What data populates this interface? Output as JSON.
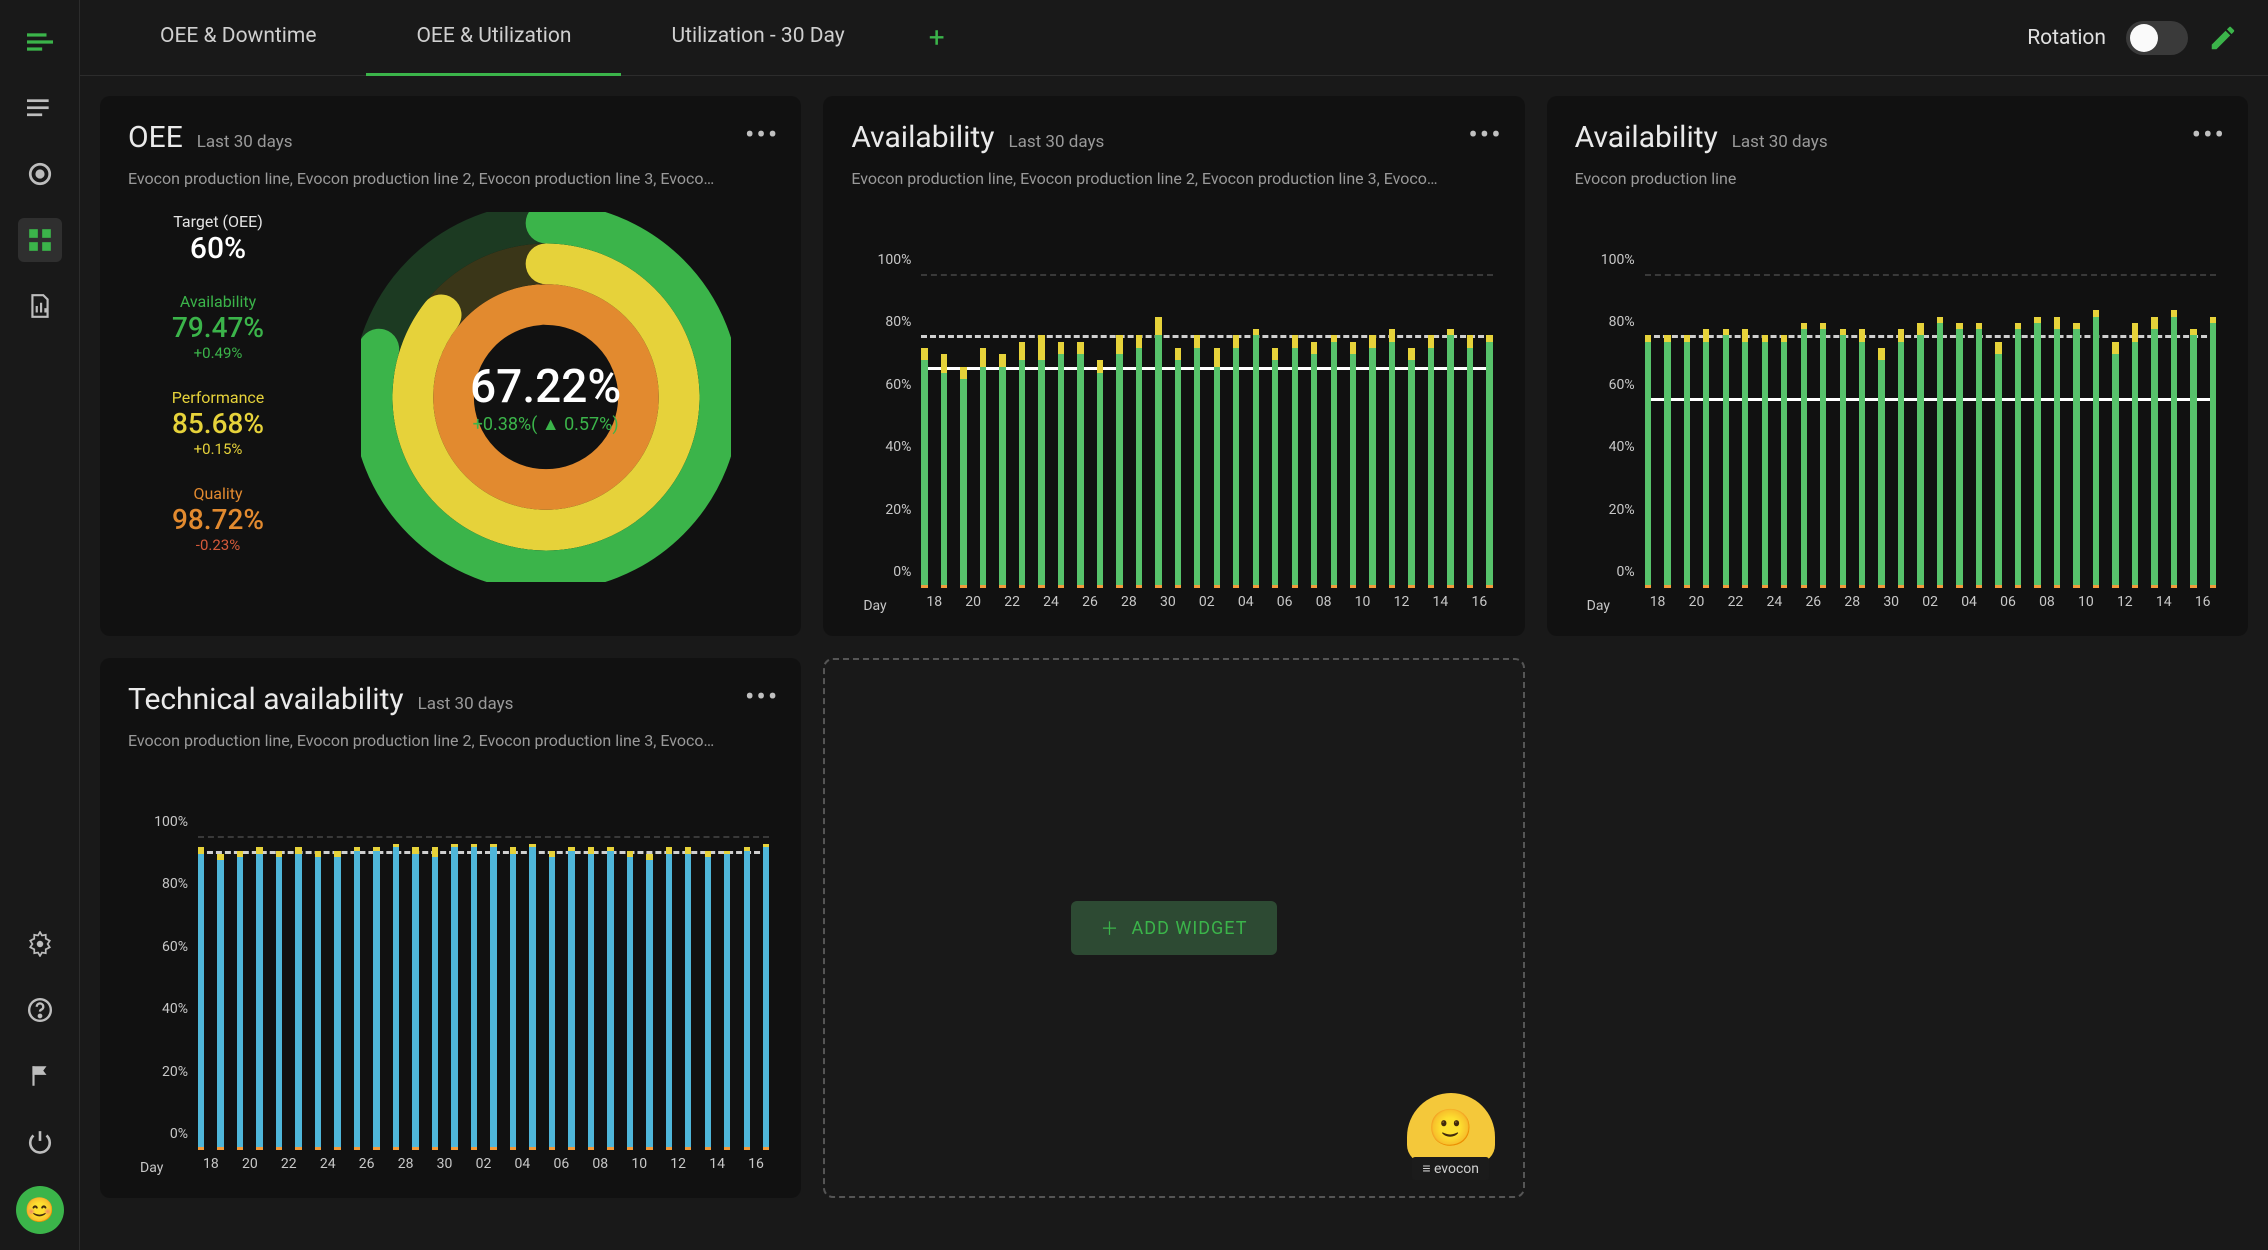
{
  "sidebar": {
    "icons": [
      "menu",
      "list",
      "target",
      "dashboard",
      "report"
    ],
    "bottom_icons": [
      "gear",
      "help",
      "flag",
      "power"
    ]
  },
  "tabs": [
    {
      "label": "OEE & Downtime",
      "active": false
    },
    {
      "label": "OEE & Utilization",
      "active": true
    },
    {
      "label": "Utilization - 30 Day",
      "active": false
    }
  ],
  "rotation": {
    "label": "Rotation",
    "on": false
  },
  "cards": {
    "oee": {
      "title": "OEE",
      "range": "Last 30 days",
      "lines": "Evocon production line, Evocon production line 2, Evocon production line 3, Evoco…",
      "target_label": "Target (OEE)",
      "target_value": "60%",
      "avail_label": "Availability",
      "avail_value": "79.47%",
      "avail_delta": "+0.49%",
      "perf_label": "Performance",
      "perf_value": "85.68%",
      "perf_delta": "+0.15%",
      "qual_label": "Quality",
      "qual_value": "98.72%",
      "qual_delta": "-0.23%",
      "main_value": "67.22%",
      "main_delta": "+0.38%( ▲ 0.57%)"
    },
    "avail_all": {
      "title": "Availability",
      "range": "Last 30 days",
      "lines": "Evocon production line, Evocon production line 2, Evocon production line 3, Evoco…"
    },
    "avail_single": {
      "title": "Availability",
      "range": "Last 30 days",
      "lines": "Evocon production line"
    },
    "tech_avail": {
      "title": "Technical availability",
      "range": "Last 30 days",
      "lines": "Evocon production line, Evocon production line 2, Evocon production line 3, Evoco…"
    },
    "placeholder": {
      "btn": "ADD WIDGET",
      "mascot": "≡ evocon"
    }
  },
  "chart_data": [
    {
      "id": "availability_all",
      "type": "bar",
      "title": "Availability – Last 30 days (all lines)",
      "ylabel": "%",
      "ylim": [
        0,
        100
      ],
      "target_dashed": 80,
      "target_solid": 70,
      "day_label": "Day",
      "categories": [
        "18",
        "20",
        "22",
        "24",
        "26",
        "28",
        "30",
        "02",
        "04",
        "06",
        "08",
        "10",
        "12",
        "14",
        "16"
      ],
      "series": [
        {
          "name": "availability",
          "color": "#57c26b",
          "values": [
            72,
            68,
            66,
            70,
            70,
            72,
            72,
            74,
            74,
            68,
            74,
            76,
            80,
            72,
            76,
            70,
            76,
            80,
            72,
            76,
            74,
            78,
            74,
            76,
            78,
            72,
            76,
            80,
            76,
            78
          ]
        },
        {
          "name": "yellow",
          "color": "#e6d23a",
          "values": [
            4,
            6,
            4,
            6,
            4,
            6,
            8,
            4,
            4,
            4,
            6,
            4,
            6,
            4,
            4,
            6,
            4,
            2,
            4,
            4,
            4,
            2,
            4,
            4,
            4,
            4,
            4,
            2,
            4,
            2
          ]
        }
      ]
    },
    {
      "id": "availability_single",
      "type": "bar",
      "title": "Availability – Last 30 days (Evocon production line)",
      "ylabel": "%",
      "ylim": [
        0,
        100
      ],
      "target_dashed": 80,
      "target_solid": 60,
      "day_label": "Day",
      "categories": [
        "18",
        "20",
        "22",
        "24",
        "26",
        "28",
        "30",
        "02",
        "04",
        "06",
        "08",
        "10",
        "12",
        "14",
        "16"
      ],
      "series": [
        {
          "name": "availability",
          "color": "#57c26b",
          "values": [
            78,
            78,
            78,
            78,
            80,
            78,
            78,
            78,
            82,
            82,
            80,
            78,
            72,
            78,
            80,
            84,
            82,
            82,
            74,
            82,
            84,
            82,
            82,
            86,
            74,
            78,
            82,
            86,
            80,
            84
          ]
        },
        {
          "name": "yellow",
          "color": "#e6d23a",
          "values": [
            2,
            2,
            2,
            4,
            2,
            4,
            2,
            2,
            2,
            2,
            2,
            4,
            4,
            4,
            4,
            2,
            2,
            2,
            4,
            2,
            2,
            4,
            2,
            2,
            4,
            6,
            4,
            2,
            2,
            2
          ]
        }
      ]
    },
    {
      "id": "technical_availability",
      "type": "bar",
      "title": "Technical availability – Last 30 days",
      "ylabel": "%",
      "ylim": [
        0,
        100
      ],
      "target_dashed": 95,
      "target_solid": null,
      "day_label": "Day",
      "categories": [
        "18",
        "20",
        "22",
        "24",
        "26",
        "28",
        "30",
        "02",
        "04",
        "06",
        "08",
        "10",
        "12",
        "14",
        "16"
      ],
      "series": [
        {
          "name": "tech_avail",
          "color": "#4fb6d9",
          "values": [
            94,
            92,
            93,
            94,
            93,
            94,
            93,
            93,
            95,
            95,
            96,
            94,
            93,
            96,
            96,
            96,
            94,
            96,
            93,
            95,
            94,
            95,
            93,
            92,
            94,
            94,
            93,
            94,
            95,
            96
          ]
        },
        {
          "name": "yellow",
          "color": "#e6d23a",
          "values": [
            2,
            2,
            2,
            2,
            2,
            2,
            2,
            2,
            1,
            1,
            1,
            2,
            3,
            1,
            1,
            1,
            2,
            1,
            2,
            1,
            2,
            1,
            2,
            2,
            2,
            2,
            2,
            1,
            1,
            1
          ]
        }
      ]
    },
    {
      "id": "oee_donut",
      "type": "pie",
      "title": "OEE rings",
      "series": [
        {
          "name": "Availability",
          "value": 79.47,
          "color": "#3bb44a"
        },
        {
          "name": "Performance",
          "value": 85.68,
          "color": "#e6d23a"
        },
        {
          "name": "Quality",
          "value": 98.72,
          "color": "#e28a2f"
        }
      ],
      "center": "67.22%"
    }
  ]
}
